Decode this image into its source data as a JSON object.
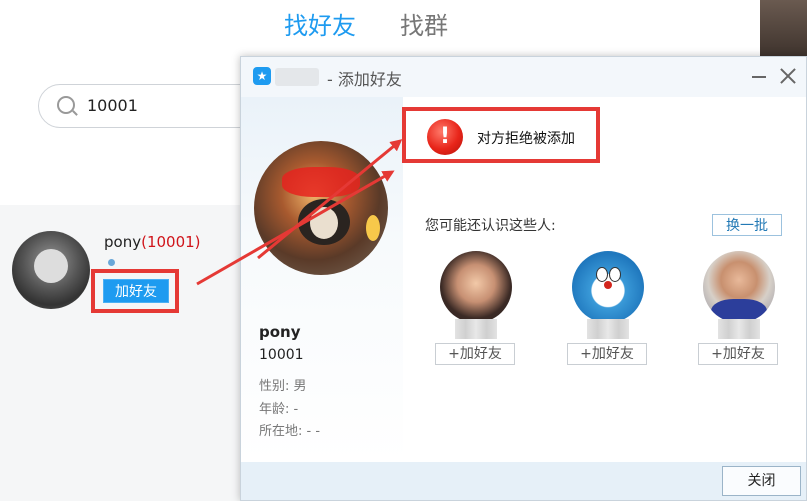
{
  "tabs": {
    "find_friend": "找好友",
    "find_group": "找群"
  },
  "search": {
    "value": "10001"
  },
  "result": {
    "name": "pony",
    "qq_paren": "(10001)",
    "add_button": "加好友"
  },
  "dialog": {
    "title": "- 添加好友",
    "close_label": "关闭",
    "profile": {
      "name": "pony",
      "qq": "10001",
      "gender": "性别: 男",
      "age": "年龄:  -",
      "location": "所在地:  -    -"
    },
    "warning": {
      "text": "对方拒绝被添加",
      "icon": "exclamation-icon"
    },
    "suggestions": {
      "title": "您可能还认识这些人:",
      "refresh": "换一批",
      "items": [
        {
          "button": "+加好友"
        },
        {
          "button": "+加好友"
        },
        {
          "button": "+加好友"
        }
      ]
    }
  },
  "colors": {
    "accent": "#1e9bf0",
    "highlight": "#e53935",
    "qq_number": "#d0141a"
  }
}
